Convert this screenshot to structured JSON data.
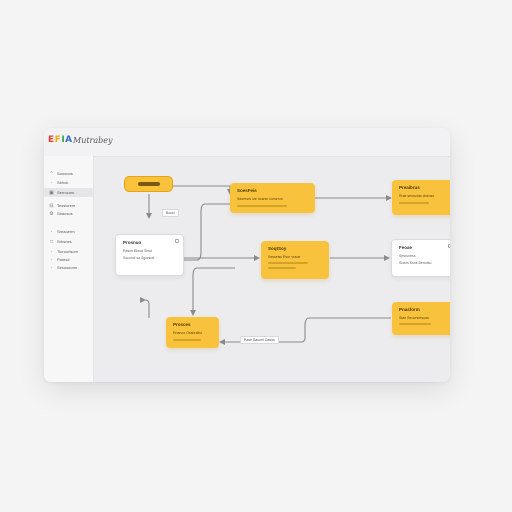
{
  "app": {
    "logo": [
      "E",
      "F",
      "I",
      "A"
    ],
    "name": "Mutrabey"
  },
  "sidebar": {
    "items": [
      {
        "icon": "up-arrow-icon",
        "glyph": "⌃",
        "label": "Sooooos",
        "active": false
      },
      {
        "icon": "grid-icon",
        "glyph": "·",
        "label": "Sbhok",
        "active": false
      },
      {
        "icon": "flow-icon",
        "glyph": "▣",
        "label": "Serrocom",
        "active": true
      },
      {
        "icon": "doc-icon",
        "glyph": "⊟",
        "label": "Tessiorem",
        "active": false
      },
      {
        "icon": "gear-icon",
        "glyph": "⚙",
        "label": "Sbaosos",
        "active": false
      },
      {
        "icon": "dot-icon",
        "glyph": "·",
        "label": "Sreaoerm",
        "active": false
      },
      {
        "icon": "box-icon",
        "glyph": "□",
        "label": "Srbsnes",
        "active": false
      },
      {
        "icon": "dot-icon",
        "glyph": "·",
        "label": "Tioroorisom",
        "active": false
      },
      {
        "icon": "dot-icon",
        "glyph": "·",
        "label": "Pamsd",
        "active": false
      },
      {
        "icon": "dot-icon",
        "glyph": "·",
        "label": "Sesosoorm",
        "active": false
      }
    ]
  },
  "diagram": {
    "start": {
      "label": ""
    },
    "nodes": {
      "n_process_top": {
        "title": "SoesFeis",
        "desc": "Sdoresrs sre dosrsn corseros",
        "style": "yellow"
      },
      "n_right_top": {
        "title": "Preaibrus",
        "desc": "Rrae sesrunas doeoso",
        "style": "yellow"
      },
      "n_white_left": {
        "title": "Prosnuo",
        "desc": "Rason Bieoo Sbsd",
        "desc2": "Ssconoi sa Sgorsraf",
        "style": "white"
      },
      "n_mid": {
        "title": "SoqtSoy",
        "desc": "Sesseiss Rsor vssoe",
        "style": "yellow"
      },
      "n_white_right": {
        "title": "Feoae",
        "desc": "Sesroness",
        "desc2": "Siosrs Ssns Berodsu",
        "style": "white"
      },
      "n_bottom_left": {
        "title": "Prosces",
        "desc": "Rnanoo Ossbrstho",
        "style": "yellow"
      },
      "n_bottom_right": {
        "title": "Pnasform",
        "desc": "Stae Seoorsresuas",
        "style": "yellow"
      }
    },
    "edge_labels": {
      "top": "Bocsi",
      "bottom": "Pase  Sasorri  Dasos"
    }
  },
  "colors": {
    "node_yellow": "#f9c23c",
    "edge": "#8a8a8a"
  }
}
